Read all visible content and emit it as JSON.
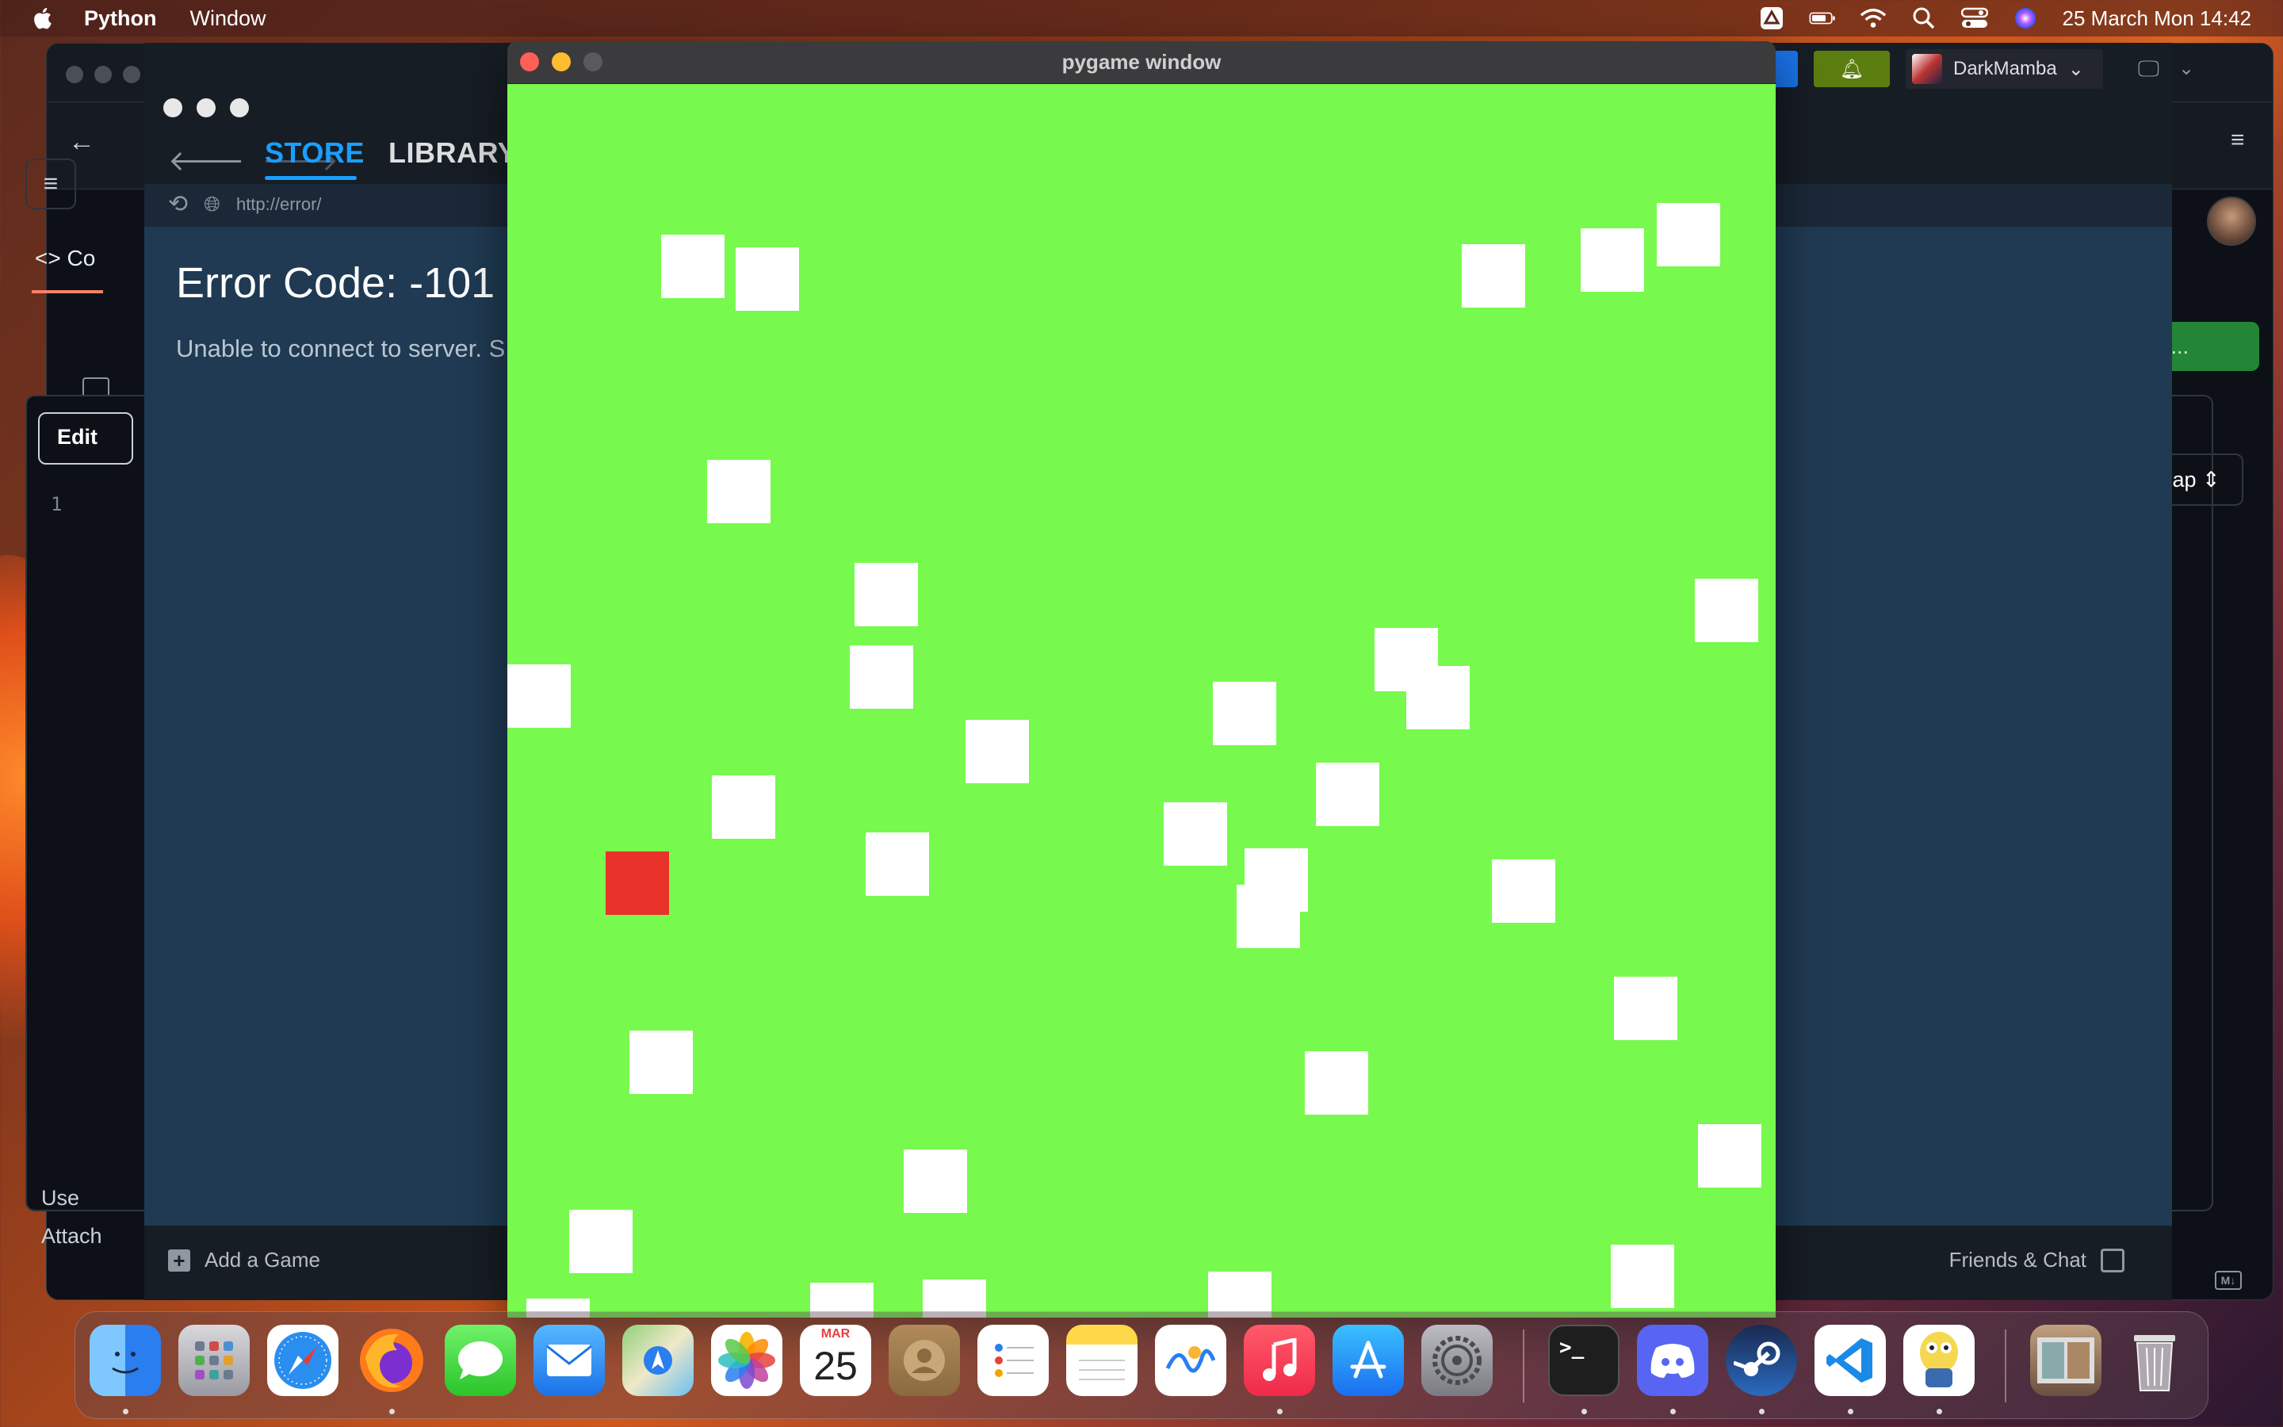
{
  "menubar": {
    "app_name": "Python",
    "menu_items": [
      "Window"
    ],
    "date_time": "25 March Mon  14:42"
  },
  "github": {
    "code_tab": "Co",
    "edit_button": "Edit",
    "line_number": "1",
    "use_text": "Use",
    "attach_text": "Attach",
    "changes_button": "nges...",
    "wrap_button": "wrap",
    "md_icon": "M↓"
  },
  "steam": {
    "tabs": [
      "STORE",
      "LIBRARY"
    ],
    "url": "http://error/",
    "error_title": "Error Code: -101",
    "error_text": "Unable to connect to server. S",
    "add_game": "Add a Game",
    "friends_chat": "Friends & Chat",
    "username": "DarkMamba"
  },
  "pygame": {
    "window_title": "pygame window",
    "background_color": "#77f94e",
    "obstacle_color": "#ffffff",
    "player_color": "#e8322a"
  },
  "dock": {
    "apps": [
      "Finder",
      "Launchpad",
      "Safari",
      "Firefox",
      "Messages",
      "Mail",
      "Maps",
      "Photos",
      "Calendar",
      "Contacts",
      "Reminders",
      "Notes",
      "Freeform",
      "Music",
      "App Store",
      "System Settings",
      "Terminal",
      "Discord",
      "Steam",
      "Visual Studio Code",
      "Python Launcher",
      "Preview",
      "Trash"
    ],
    "calendar_month": "MAR",
    "calendar_day": "25"
  }
}
